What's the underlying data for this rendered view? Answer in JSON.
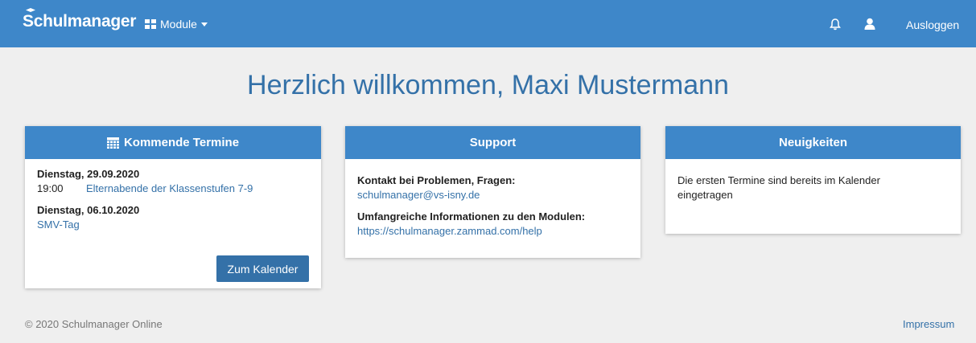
{
  "navbar": {
    "brand": "Schulmanager",
    "module_menu_label": "Module",
    "logout_label": "Ausloggen",
    "background": "#3e87c9"
  },
  "welcome": "Herzlich willkommen, Maxi Mustermann",
  "termine": {
    "title": "Kommende Termine",
    "entries": [
      {
        "date": "Dienstag, 29.09.2020",
        "time": "19:00",
        "event": "Elternabende der Klassenstufen 7-9"
      },
      {
        "date": "Dienstag, 06.10.2020",
        "time": "",
        "event": "SMV-Tag"
      }
    ],
    "button_label": "Zum Kalender"
  },
  "support": {
    "title": "Support",
    "contact_label": "Kontakt bei Problemen, Fragen:",
    "contact_email": "schulmanager@vs-isny.de",
    "info_label": "Umfangreiche Informationen zu den Modulen:",
    "info_url": "https://schulmanager.zammad.com/help"
  },
  "news": {
    "title": "Neuigkeiten",
    "text": "Die ersten Termine sind bereits im Kalender eingetragen"
  },
  "footer": {
    "copyright": "© 2020 Schulmanager Online",
    "impressum": "Impressum"
  },
  "icons": [
    "graduation-cap-icon",
    "grid-icon",
    "caret-down-icon",
    "bell-icon",
    "user-icon",
    "calendar-icon"
  ]
}
